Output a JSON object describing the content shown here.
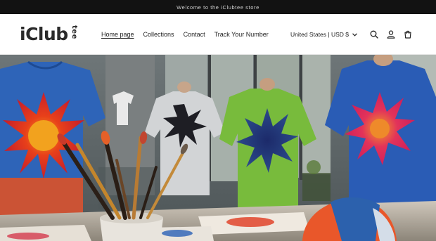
{
  "announcement": {
    "text": "Welcome to the iClubtee store"
  },
  "logo": {
    "main": "iClub",
    "suffix": "tee"
  },
  "nav": {
    "items": [
      {
        "label": "Home page",
        "active": true
      },
      {
        "label": "Collections",
        "active": false
      },
      {
        "label": "Contact",
        "active": false
      },
      {
        "label": "Track Your Number",
        "active": false
      }
    ]
  },
  "header_tools": {
    "country_label": "United States | USD $",
    "icons": [
      "search-icon",
      "account-icon",
      "cart-icon"
    ]
  },
  "colors": {
    "announcement_bg": "#121212",
    "header_bg": "#ffffff",
    "text": "#121212"
  },
  "hero": {
    "image": "tie-dye t-shirts displayed in an art studio with paint brushes"
  }
}
